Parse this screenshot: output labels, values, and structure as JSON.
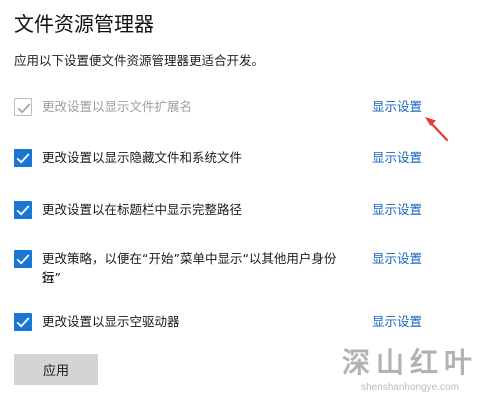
{
  "page": {
    "title": "文件资源管理器",
    "description": "应用以下设置便文件资源管理器更适合开发。"
  },
  "settings": [
    {
      "label_line1": "更改设置以显示文件扩展名",
      "label_line2": "",
      "checked": true,
      "enabled": false,
      "link": "显示设置"
    },
    {
      "label_line1": "更改设置以显示隐藏文件和系统文件",
      "label_line2": "",
      "checked": true,
      "enabled": true,
      "link": "显示设置"
    },
    {
      "label_line1": "更改设置以在标题栏中显示完整路径",
      "label_line2": "",
      "checked": true,
      "enabled": true,
      "link": "显示设置"
    },
    {
      "label_line1": "更改策略，以便在“开始”菜单中显示“以其他用户身份运",
      "label_line2": "行”",
      "checked": true,
      "enabled": true,
      "link": "显示设置"
    },
    {
      "label_line1": "更改设置以显示空驱动器",
      "label_line2": "",
      "checked": true,
      "enabled": true,
      "link": "显示设置"
    }
  ],
  "actions": {
    "apply_label": "应用"
  },
  "watermark": {
    "brand": "深山红叶",
    "url": "shenshanhongye.com"
  },
  "colors": {
    "accent": "#1976d2",
    "link": "#1565c0",
    "arrow": "#e53935",
    "button": "#d4d4d4"
  },
  "icons": {
    "checkbox": "checkmark-icon",
    "annotation": "red-arrow-icon"
  }
}
